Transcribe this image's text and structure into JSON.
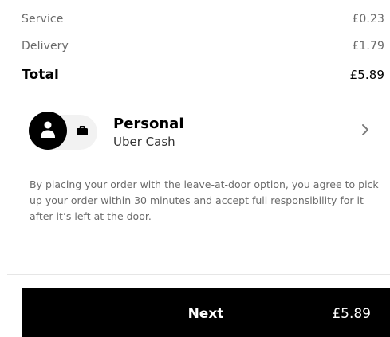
{
  "fees": {
    "service_label": "Service",
    "service_value": "£0.23",
    "delivery_label": "Delivery",
    "delivery_value": "£1.79",
    "total_label": "Total",
    "total_value": "£5.89"
  },
  "payment": {
    "name": "Personal",
    "method": "Uber Cash",
    "avatar_icon": "person-icon",
    "profile_icon": "briefcase-icon",
    "chevron_icon": "chevron-right-icon"
  },
  "notice": {
    "text": "By placing your order with the leave-at-door option, you agree to pick up your order within 30 minutes and accept full responsibility for it after it’s left at the door."
  },
  "footer": {
    "next_label": "Next",
    "next_price": "£5.89"
  },
  "colors": {
    "primary": "#000000",
    "muted_text": "#6b6b6b",
    "background": "#ffffff"
  }
}
